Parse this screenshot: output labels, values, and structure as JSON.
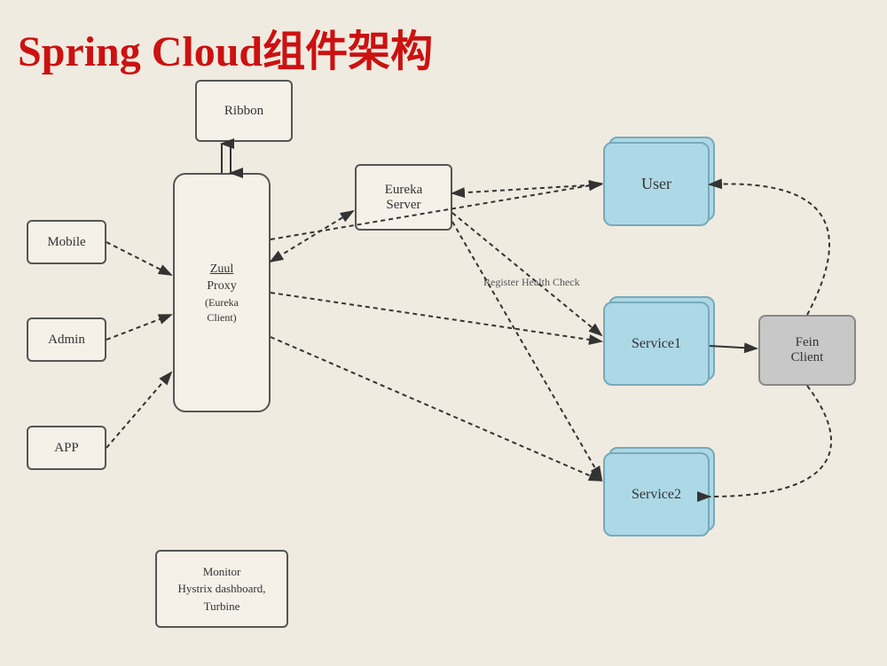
{
  "title": "Spring Cloud组件架构",
  "nodes": {
    "ribbon": "Ribbon",
    "zuul": "Zuul\nProxy\n(Eureka\nClient)",
    "eureka": "Eureka\nServer",
    "mobile": "Mobile",
    "admin": "Admin",
    "app": "APP",
    "monitor": "Monitor\nHystrix dashboard,\nTurbine",
    "user": "User",
    "service1": "Service1",
    "service2": "Service2",
    "fein": "Fein\nClient",
    "register_label": "Register\nHealth Check"
  },
  "colors": {
    "title": "#cc1111",
    "background": "#f0ebe0",
    "box_border": "#555555",
    "box_bg": "#f5f0e8",
    "blue_bg": "#add8e6",
    "blue_border": "#7aabbf",
    "gray_bg": "#c8c8c8",
    "gray_border": "#888888",
    "arrow": "#333333"
  }
}
